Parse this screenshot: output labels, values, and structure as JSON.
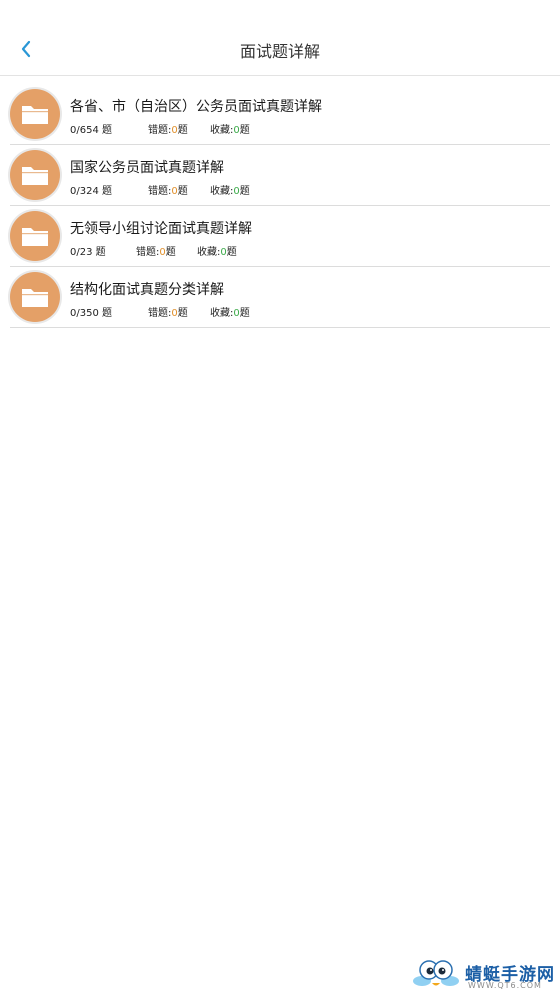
{
  "header": {
    "title": "面试题详解",
    "back_icon": "chevron-left-icon",
    "accent": "#2a97d6"
  },
  "items": [
    {
      "title": "各省、市（自治区）公务员面试真题详解",
      "progress": "0/654 题",
      "wrong_label": "错题:",
      "wrong_count": "0",
      "wrong_unit": "题",
      "fav_label": "收藏:",
      "fav_count": "0",
      "fav_unit": "题"
    },
    {
      "title": "国家公务员面试真题详解",
      "progress": "0/324 题",
      "wrong_label": "错题:",
      "wrong_count": "0",
      "wrong_unit": "题",
      "fav_label": "收藏:",
      "fav_count": "0",
      "fav_unit": "题"
    },
    {
      "title": "无领导小组讨论面试真题详解",
      "progress": "0/23 题",
      "wrong_label": "错题:",
      "wrong_count": "0",
      "wrong_unit": "题",
      "fav_label": "收藏:",
      "fav_count": "0",
      "fav_unit": "题"
    },
    {
      "title": "结构化面试真题分类详解",
      "progress": "0/350 题",
      "wrong_label": "错题:",
      "wrong_count": "0",
      "wrong_unit": "题",
      "fav_label": "收藏:",
      "fav_count": "0",
      "fav_unit": "题"
    }
  ],
  "colors": {
    "folder_bg": "#e4a067",
    "wrong_count": "#e0902c",
    "fav_count": "#3caa4a"
  },
  "watermark": {
    "name": "蜻蜓手游网",
    "url": "WWW.QT6.COM",
    "icon": "dragonfly-logo-icon"
  }
}
